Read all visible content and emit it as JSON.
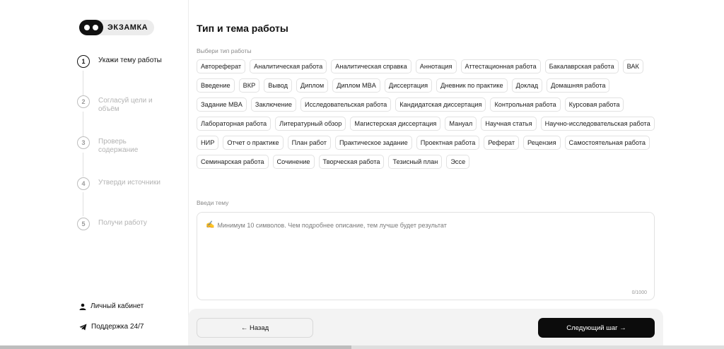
{
  "logo": {
    "text": "ЭКЗАМКА"
  },
  "steps": [
    {
      "num": "1",
      "label": "Укажи тему работы",
      "active": true
    },
    {
      "num": "2",
      "label": "Согласуй цели и объём",
      "active": false
    },
    {
      "num": "3",
      "label": "Проверь содержание",
      "active": false
    },
    {
      "num": "4",
      "label": "Утверди источники",
      "active": false
    },
    {
      "num": "5",
      "label": "Получи работу",
      "active": false
    }
  ],
  "sidebar_links": {
    "account": "Личный кабинет",
    "support": "Поддержка 24/7"
  },
  "main": {
    "title": "Тип и тема работы",
    "type_label": "Выбери тип работы",
    "topic_label": "Введи тему",
    "topic_placeholder": "Минимум 10 символов. Чем подробнее описание, тем лучше будет результат",
    "topic_counter": "0/1000"
  },
  "work_types": [
    "Автореферат",
    "Аналитическая работа",
    "Аналитическая справка",
    "Аннотация",
    "Аттестационная работа",
    "Бакалаврская работа",
    "ВАК",
    "Введение",
    "ВКР",
    "Вывод",
    "Диплом",
    "Диплом MBA",
    "Диссертация",
    "Дневник по практике",
    "Доклад",
    "Домашняя работа",
    "Задание MBA",
    "Заключение",
    "Исследовательская работа",
    "Кандидатская диссертация",
    "Контрольная работа",
    "Курсовая работа",
    "Лабораторная работа",
    "Литературный обзор",
    "Магистерская диссертация",
    "Мануал",
    "Научная статья",
    "Научно-исследовательская работа",
    "НИР",
    "Отчет о практике",
    "План работ",
    "Практическое задание",
    "Проектная работа",
    "Реферат",
    "Рецензия",
    "Самостоятельная работа",
    "Семинарская работа",
    "Сочинение",
    "Творческая работа",
    "Тезисный план",
    "Эссе"
  ],
  "footer": {
    "back_label": "← Назад",
    "next_label": "Следующий шаг →"
  },
  "colors": {
    "accent": "#0c0c0c",
    "muted": "#b3b3b3"
  }
}
